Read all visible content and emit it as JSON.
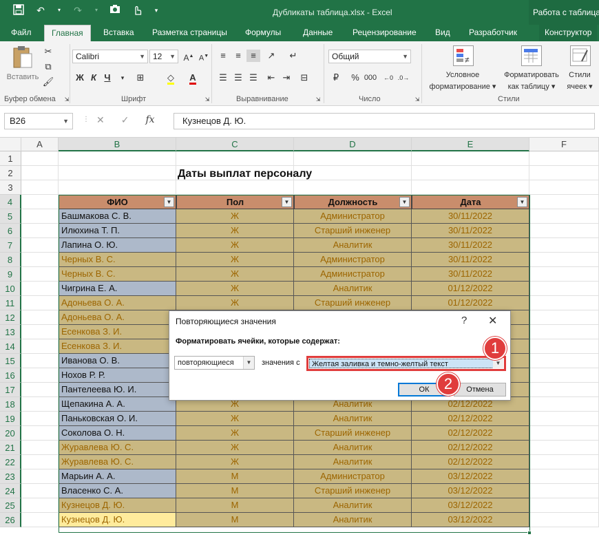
{
  "window": {
    "title": "Дубликаты таблица.xlsx - Excel",
    "context_title": "Работа с таблицами"
  },
  "tabs": [
    {
      "label": "Файл"
    },
    {
      "label": "Главная",
      "active": true
    },
    {
      "label": "Вставка"
    },
    {
      "label": "Разметка страницы"
    },
    {
      "label": "Формулы"
    },
    {
      "label": "Данные"
    },
    {
      "label": "Рецензирование"
    },
    {
      "label": "Вид"
    },
    {
      "label": "Разработчик"
    },
    {
      "label": "Конструктор"
    }
  ],
  "ribbon": {
    "clipboard": {
      "paste_label": "Вставить",
      "group": "Буфер обмена"
    },
    "font": {
      "name": "Calibri",
      "size": "12",
      "group": "Шрифт",
      "bold": "Ж",
      "italic": "К",
      "underline": "Ч"
    },
    "alignment": {
      "group": "Выравнивание"
    },
    "number": {
      "format": "Общий",
      "group": "Число"
    },
    "styles": {
      "group": "Стили",
      "conditional_1": "Условное",
      "conditional_2": "форматирование",
      "format_table_1": "Форматировать",
      "format_table_2": "как таблицу",
      "cell_styles_1": "Стили",
      "cell_styles_2": "ячеек"
    }
  },
  "formula_bar": {
    "name_box": "B26",
    "fx": "fx",
    "value": "Кузнецов Д. Ю."
  },
  "columns": [
    "A",
    "B",
    "C",
    "D",
    "E",
    "F"
  ],
  "rows": [
    "1",
    "2",
    "3",
    "4",
    "5",
    "6",
    "7",
    "8",
    "9",
    "10",
    "11",
    "12",
    "13",
    "14",
    "15",
    "16",
    "17",
    "18",
    "19",
    "20",
    "21",
    "22",
    "23",
    "24",
    "25",
    "26"
  ],
  "sheet": {
    "title": "Даты выплат персоналу",
    "headers": [
      "ФИО",
      "Пол",
      "Должность",
      "Дата"
    ],
    "data": [
      {
        "fio": "Башмакова С. В.",
        "pol": "Ж",
        "dolzh": "Администратор",
        "data": "30/11/2022",
        "dup": false
      },
      {
        "fio": "Илюхина Т. П.",
        "pol": "Ж",
        "dolzh": "Старший инженер",
        "data": "30/11/2022",
        "dup": false
      },
      {
        "fio": "Лапина О. Ю.",
        "pol": "Ж",
        "dolzh": "Аналитик",
        "data": "30/11/2022",
        "dup": false
      },
      {
        "fio": "Черных В. С.",
        "pol": "Ж",
        "dolzh": "Администратор",
        "data": "30/11/2022",
        "dup": true
      },
      {
        "fio": "Черных В. С.",
        "pol": "Ж",
        "dolzh": "Администратор",
        "data": "30/11/2022",
        "dup": true
      },
      {
        "fio": "Чигрина Е. А.",
        "pol": "Ж",
        "dolzh": "Аналитик",
        "data": "01/12/2022",
        "dup": false
      },
      {
        "fio": "Адоньева О. А.",
        "pol": "Ж",
        "dolzh": "Старший инженер",
        "data": "01/12/2022",
        "dup": true
      },
      {
        "fio": "Адоньева О. А.",
        "pol": "",
        "dolzh": "",
        "data": "",
        "dup": true
      },
      {
        "fio": "Есенкова З. И.",
        "pol": "",
        "dolzh": "",
        "data": "",
        "dup": true
      },
      {
        "fio": "Есенкова З. И.",
        "pol": "",
        "dolzh": "",
        "data": "",
        "dup": true
      },
      {
        "fio": "Иванова О. В.",
        "pol": "",
        "dolzh": "",
        "data": "",
        "dup": false
      },
      {
        "fio": "Нохов Р. Р.",
        "pol": "",
        "dolzh": "",
        "data": "",
        "dup": false
      },
      {
        "fio": "Пантелеева Ю. И.",
        "pol": "",
        "dolzh": "",
        "data": "",
        "dup": false
      },
      {
        "fio": "Щепакина А. А.",
        "pol": "Ж",
        "dolzh": "Аналитик",
        "data": "02/12/2022",
        "dup": false
      },
      {
        "fio": "Паньковская О. И.",
        "pol": "Ж",
        "dolzh": "Аналитик",
        "data": "02/12/2022",
        "dup": false
      },
      {
        "fio": "Соколова О. Н.",
        "pol": "Ж",
        "dolzh": "Старший инженер",
        "data": "02/12/2022",
        "dup": false
      },
      {
        "fio": "Журавлева Ю. С.",
        "pol": "Ж",
        "dolzh": "Аналитик",
        "data": "02/12/2022",
        "dup": true
      },
      {
        "fio": "Журавлева Ю. С.",
        "pol": "Ж",
        "dolzh": "Аналитик",
        "data": "02/12/2022",
        "dup": true
      },
      {
        "fio": "Марьин А. А.",
        "pol": "М",
        "dolzh": "Администратор",
        "data": "03/12/2022",
        "dup": false
      },
      {
        "fio": "Власенко С. А.",
        "pol": "М",
        "dolzh": "Старший инженер",
        "data": "03/12/2022",
        "dup": false
      },
      {
        "fio": "Кузнецов Д. Ю.",
        "pol": "М",
        "dolzh": "Аналитик",
        "data": "03/12/2022",
        "dup": true
      },
      {
        "fio": "Кузнецов Д. Ю.",
        "pol": "М",
        "dolzh": "Аналитик",
        "data": "03/12/2022",
        "dup": true,
        "active": true
      }
    ]
  },
  "dialog": {
    "title": "Повторяющиеся значения",
    "help": "?",
    "close": "✕",
    "prompt": "Форматировать ячейки, которые содержат:",
    "rule_value": "повторяющиеся",
    "values_with": "значения с",
    "format_value": "Желтая заливка и темно-желтый текст",
    "ok": "ОК",
    "cancel": "Отмена"
  },
  "badges": [
    "1",
    "2"
  ],
  "colors": {
    "excel_green": "#217346",
    "header_fill": "#c98d6c",
    "name_fill": "#adb9ca",
    "dup_fill": "#c9b882",
    "dup_text": "#9c6500",
    "callout": "#e03c3c"
  }
}
